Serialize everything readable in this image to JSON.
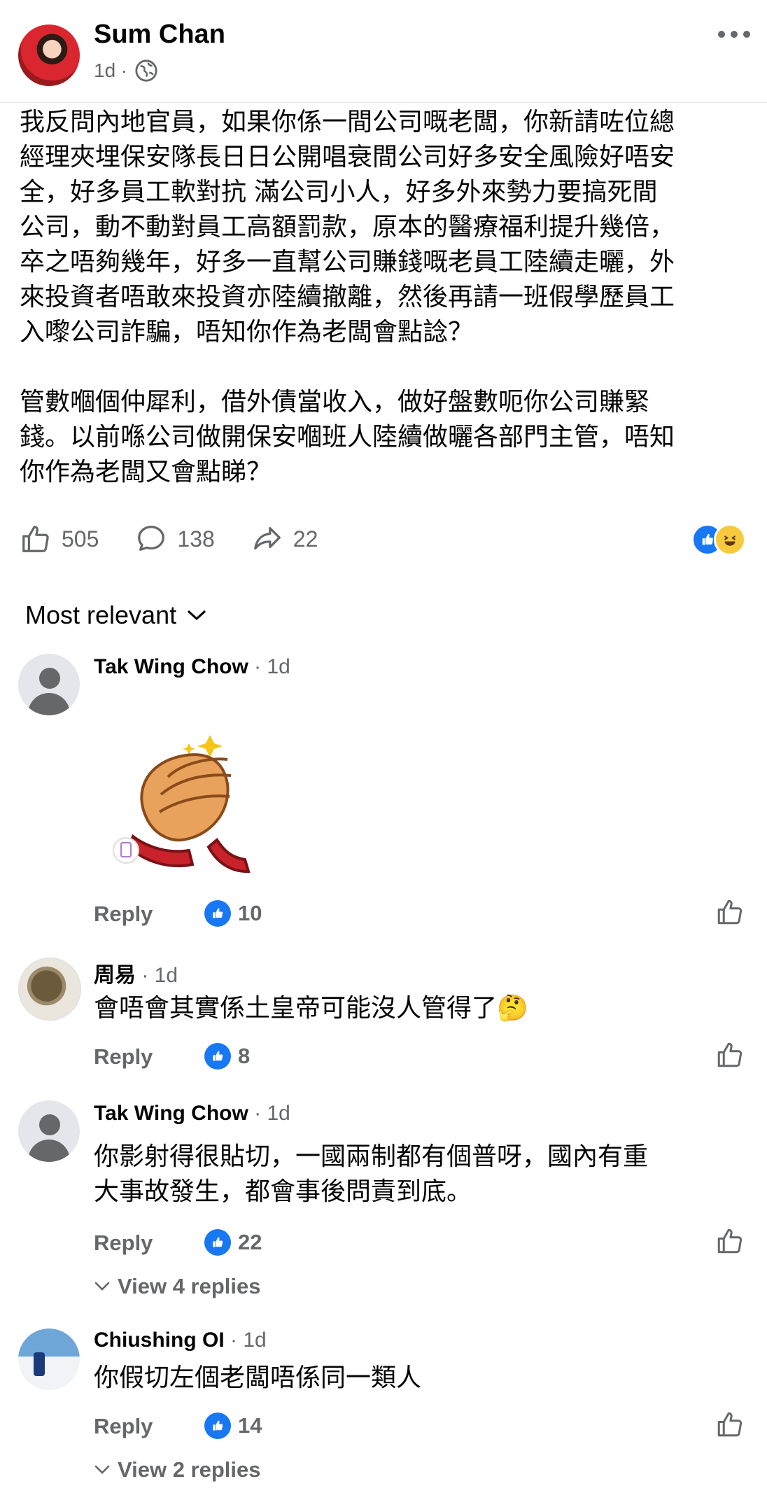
{
  "post": {
    "author": "Sum Chan",
    "time": "1d ·",
    "text": "我反問內地官員，如果你係一間公司嘅老闆，你新請咗位總\n經理夾埋保安隊長日日公開唱衰間公司好多安全風險好唔安\n全，好多員工軟對抗 滿公司小人，好多外來勢力要搞死間\n公司，動不動對員工高額罰款，原本的醫療福利提升幾倍，\n卒之唔夠幾年，好多一直幫公司賺錢嘅老員工陸續走曬，外\n來投資者唔敢來投資亦陸續撤離，然後再請一班假學歷員工\n入嚟公司詐騙，唔知你作為老闆會點諗？\n\n管數嗰個仲犀利，借外債當收入，做好盤數呃你公司賺緊\n錢。以前喺公司做開保安嗰班人陸續做曬各部門主管，唔知\n你作為老闆又會點睇？",
    "likes": "505",
    "comments": "138",
    "shares": "22"
  },
  "sort_label": "Most relevant",
  "comments": [
    {
      "name": "Tak Wing Chow",
      "time": " · 1d",
      "text": "",
      "reply": "Reply",
      "likes": "10"
    },
    {
      "name": "周易",
      "time": " · 1d",
      "text": "會唔會其實係土皇帝可能沒人管得了🤔",
      "reply": "Reply",
      "likes": "8"
    },
    {
      "name": "Tak Wing Chow",
      "time": " · 1d",
      "text": "你影射得很貼切，一國兩制都有個普呀，國內有重\n大事故發生，都會事後問責到底。",
      "reply": "Reply",
      "likes": "22",
      "view_replies": "View 4 replies"
    },
    {
      "name": "Chiushing OI",
      "time": " · 1d",
      "text": "你假切左個老闆唔係同一類人",
      "reply": "Reply",
      "likes": "14",
      "view_replies": "View 2 replies"
    }
  ],
  "colors": {
    "accent": "#1877f2",
    "muted": "#65676b"
  }
}
